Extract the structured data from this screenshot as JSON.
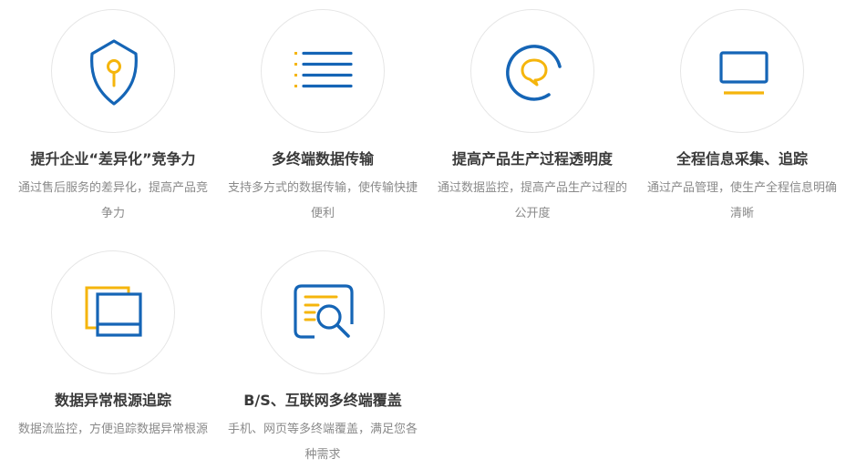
{
  "colors": {
    "blue": "#1565b6",
    "yellow": "#f5b50c",
    "title": "#3a3a3a",
    "desc": "#8a8a8a",
    "circle_border": "#e6e6e6"
  },
  "features": [
    {
      "icon": "shield-key-icon",
      "title": "提升企业“差异化”竞争力",
      "desc": "通过售后服务的差异化，提高产品竞争力"
    },
    {
      "icon": "list-icon",
      "title": "多终端数据传输",
      "desc": "支持多方式的数据传输，使传输快捷便利"
    },
    {
      "icon": "chat-bubble-icon",
      "title": "提高产品生产过程透明度",
      "desc": "通过数据监控，提高产品生产过程的公开度"
    },
    {
      "icon": "monitor-icon",
      "title": "全程信息采集、追踪",
      "desc": "通过产品管理，使生产全程信息明确清晰"
    },
    {
      "icon": "stacked-windows-icon",
      "title": "数据异常根源追踪",
      "desc": "数据流监控，方便追踪数据异常根源"
    },
    {
      "icon": "document-search-icon",
      "title": "B/S、互联网多终端覆盖",
      "desc": "手机、网页等多终端覆盖，满足您各种需求"
    }
  ]
}
